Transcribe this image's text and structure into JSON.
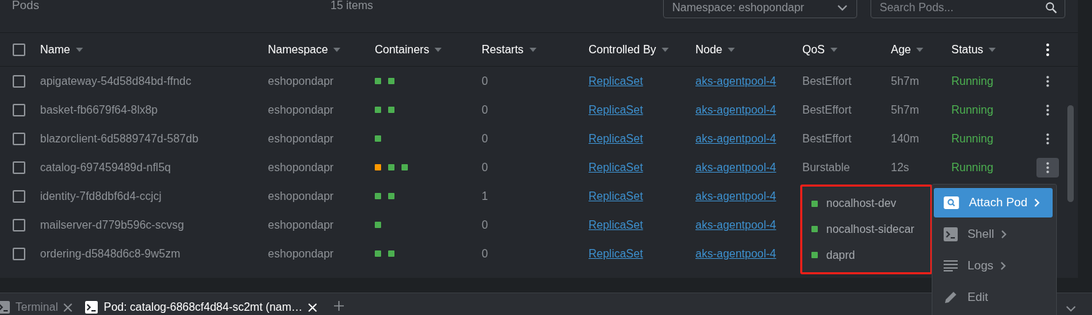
{
  "header": {
    "title": "Pods",
    "count": "15 items",
    "namespace_select": "Namespace: eshopondapr",
    "search": {
      "placeholder": "Search Pods..."
    }
  },
  "table": {
    "select_all": {
      "checked": false
    },
    "columns": [
      "Name",
      "Namespace",
      "Containers",
      "Restarts",
      "Controlled By",
      "Node",
      "QoS",
      "Age",
      "Status"
    ],
    "rows": [
      {
        "checked": false,
        "name": "apigateway-54d58d84bd-ffndc",
        "namespace": "eshopondapr",
        "containers": [
          {
            "color": "#4caf50"
          },
          {
            "color": "#4caf50"
          }
        ],
        "restarts": "0",
        "controlled_by": "ReplicaSet",
        "node": "aks-agentpool-4",
        "qos": "BestEffort",
        "age": "5h7m",
        "status": "Running",
        "menu_active": false
      },
      {
        "checked": false,
        "name": "basket-fb6679f64-8lx8p",
        "namespace": "eshopondapr",
        "containers": [
          {
            "color": "#4caf50"
          },
          {
            "color": "#4caf50"
          }
        ],
        "restarts": "0",
        "controlled_by": "ReplicaSet",
        "node": "aks-agentpool-4",
        "qos": "BestEffort",
        "age": "5h7m",
        "status": "Running",
        "menu_active": false
      },
      {
        "checked": false,
        "name": "blazorclient-6d5889747d-587db",
        "namespace": "eshopondapr",
        "containers": [
          {
            "color": "#4caf50"
          }
        ],
        "restarts": "0",
        "controlled_by": "ReplicaSet",
        "node": "aks-agentpool-4",
        "qos": "BestEffort",
        "age": "140m",
        "status": "Running",
        "menu_active": false
      },
      {
        "checked": false,
        "name": "catalog-697459489d-nfl5q",
        "namespace": "eshopondapr",
        "containers": [
          {
            "color": "#ff9800"
          },
          {
            "color": "#4caf50"
          },
          {
            "color": "#4caf50"
          }
        ],
        "restarts": "0",
        "controlled_by": "ReplicaSet",
        "node": "aks-agentpool-4",
        "qos": "Burstable",
        "age": "12s",
        "status": "Running",
        "menu_active": true
      },
      {
        "checked": false,
        "name": "identity-7fd8dbf6d4-ccjcj",
        "namespace": "eshopondapr",
        "containers": [
          {
            "color": "#4caf50"
          },
          {
            "color": "#4caf50"
          }
        ],
        "restarts": "1",
        "controlled_by": "ReplicaSet",
        "node": "aks-agentpool-4"
      },
      {
        "checked": false,
        "name": "mailserver-d779b596c-scvsg",
        "namespace": "eshopondapr",
        "containers": [
          {
            "color": "#4caf50"
          }
        ],
        "restarts": "0",
        "controlled_by": "ReplicaSet",
        "node": "aks-agentpool-4"
      },
      {
        "checked": false,
        "name": "ordering-d5848d6c8-9w5zm",
        "namespace": "eshopondapr",
        "containers": [
          {
            "color": "#4caf50"
          },
          {
            "color": "#4caf50"
          }
        ],
        "restarts": "0",
        "controlled_by": "ReplicaSet",
        "node": "aks-agentpool-4"
      }
    ]
  },
  "container_popup": {
    "items": [
      {
        "name": "nocalhost-dev",
        "color": "#4caf50"
      },
      {
        "name": "nocalhost-sidecar",
        "color": "#4caf50"
      },
      {
        "name": "daprd",
        "color": "#4caf50"
      }
    ]
  },
  "context_menu": {
    "items": [
      {
        "kind": "attach",
        "label": "Attach Pod",
        "submenu": true,
        "selected": true
      },
      {
        "kind": "shell",
        "label": "Shell",
        "submenu": true,
        "selected": false
      },
      {
        "kind": "logs",
        "label": "Logs",
        "submenu": true,
        "selected": false
      },
      {
        "kind": "edit",
        "label": "Edit",
        "submenu": false,
        "selected": false
      }
    ]
  },
  "dock": {
    "tabs": [
      {
        "label": "Terminal",
        "selected": false
      },
      {
        "label": "Pod: catalog-6868cf4d84-sc2mt (nam…",
        "selected": true
      }
    ]
  }
}
